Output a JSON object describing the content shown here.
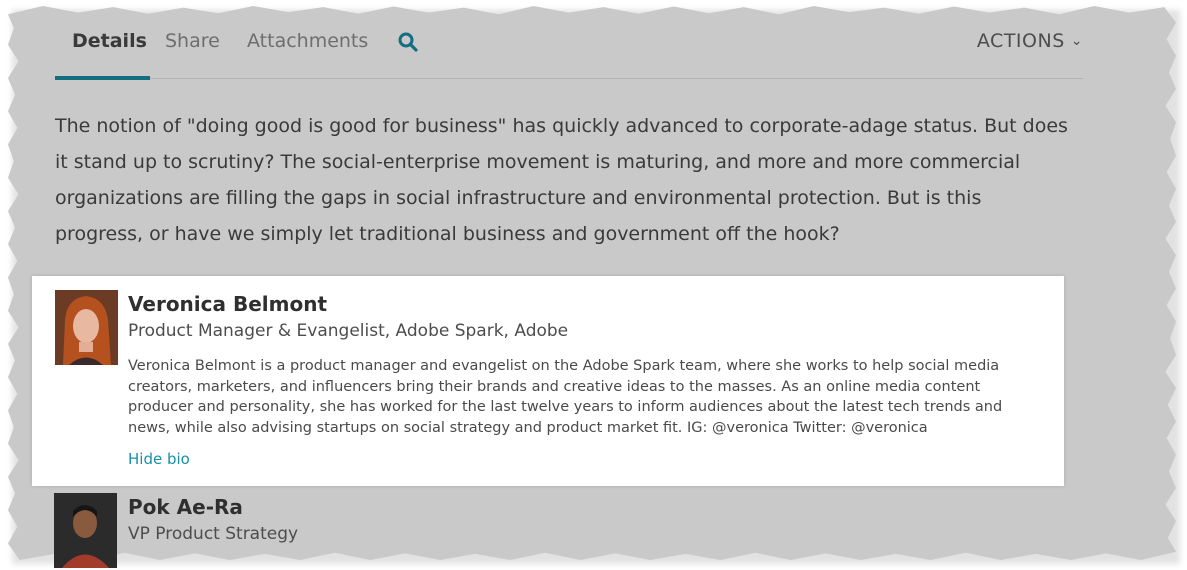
{
  "tabs": {
    "items": [
      {
        "label": "Details",
        "active": true
      },
      {
        "label": "Share",
        "active": false
      },
      {
        "label": "Attachments",
        "active": false
      }
    ],
    "actions_label": "ACTIONS"
  },
  "description": "The notion of \"doing good is good for business\" has quickly advanced to corporate-adage status. But does it stand up to scrutiny? The social-enterprise movement is maturing, and more and more commercial organizations are filling the gaps in social infrastructure and environmental protection. But is this progress, or have we simply let traditional business and government off the hook?",
  "speakers": [
    {
      "name": "Veronica Belmont",
      "title": "Product Manager & Evangelist, Adobe Spark, Adobe",
      "bio": "Veronica Belmont is a product manager and evangelist on the Adobe Spark team, where she works to help social media creators, marketers, and influencers bring their brands and creative ideas to the masses. As an online media content producer and personality, she has worked for the last twelve years to inform audiences about the latest tech trends and news, while also advising startups on social strategy and product market fit. IG: @veronica Twitter: @veronica",
      "bio_toggle": "Hide bio"
    },
    {
      "name": "Pok Ae-Ra",
      "title": "VP Product Strategy"
    }
  ],
  "colors": {
    "accent": "#136e80",
    "link": "#1a8fa8",
    "background": "#c9c9c9"
  }
}
